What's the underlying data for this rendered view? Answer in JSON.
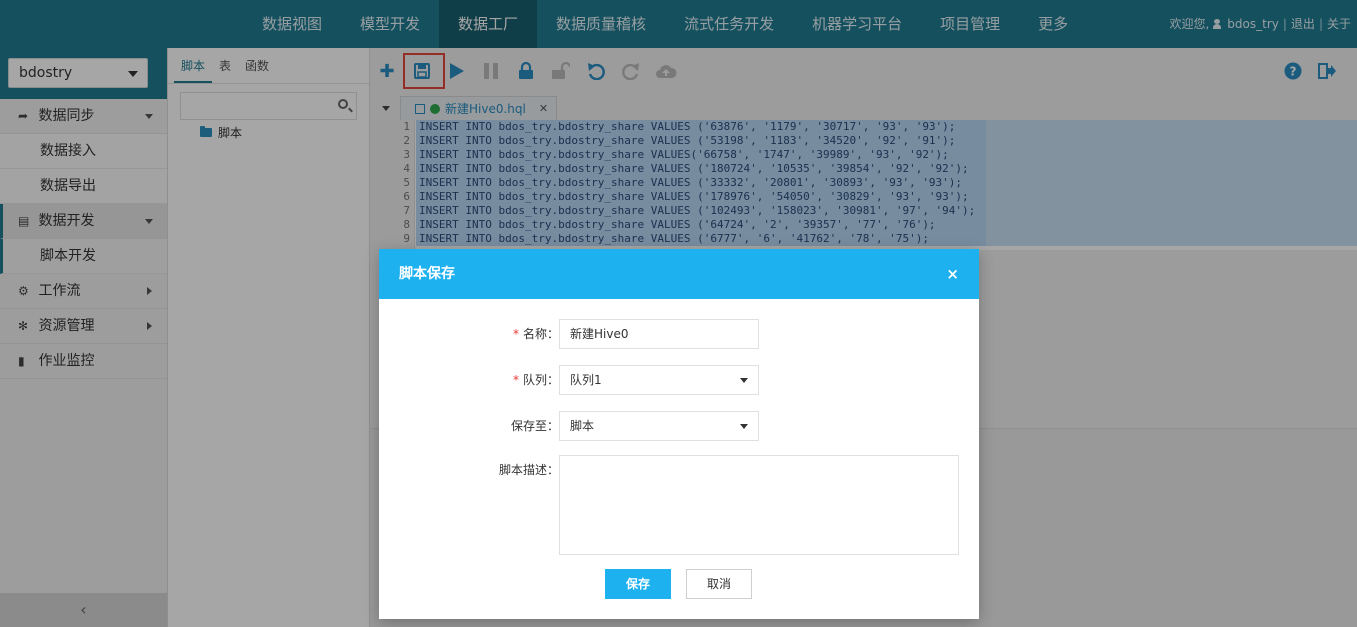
{
  "topnav": {
    "items": [
      "数据视图",
      "模型开发",
      "数据工厂",
      "数据质量稽核",
      "流式任务开发",
      "机器学习平台",
      "项目管理",
      "更多"
    ],
    "active_index": 2,
    "welcome": "欢迎您,",
    "username": "bdos_try",
    "logout": "退出",
    "about": "关于",
    "sep": "|"
  },
  "sidebar": {
    "project": "bdostry",
    "menu": [
      {
        "label": "数据同步",
        "icon": "share-icon"
      },
      {
        "label": "数据接入"
      },
      {
        "label": "数据导出"
      },
      {
        "label": "数据开发",
        "icon": "code-icon"
      },
      {
        "label": "脚本开发"
      },
      {
        "label": "工作流",
        "icon": "cogs-icon"
      },
      {
        "label": "资源管理",
        "icon": "gear-icon"
      },
      {
        "label": "作业监控",
        "icon": "server-icon"
      }
    ],
    "collapse_glyph": "‹"
  },
  "panel2": {
    "tabs": [
      "脚本",
      "表",
      "函数"
    ],
    "tree_root": "脚本"
  },
  "editor": {
    "file_tab": "新建Hive0.hql",
    "lines": [
      "INSERT INTO bdos_try.bdostry_share VALUES ('63876', '1179', '30717', '93', '93');",
      "INSERT INTO bdos_try.bdostry_share VALUES ('53198', '1183', '34520', '92', '91');",
      "INSERT INTO bdos_try.bdostry_share VALUES('66758', '1747', '39989', '93', '92');",
      "INSERT INTO bdos_try.bdostry_share VALUES ('180724', '10535', '39854', '92', '92');",
      "INSERT INTO bdos_try.bdostry_share VALUES ('33332', '20801', '30893', '93', '93');",
      "INSERT INTO bdos_try.bdostry_share VALUES ('178976', '54050', '30829', '93', '93');",
      "INSERT INTO bdos_try.bdostry_share VALUES ('102493', '158023', '30981', '97', '94');",
      "INSERT INTO bdos_try.bdostry_share VALUES ('64724', '2', '39357', '77', '76');",
      "INSERT INTO bdos_try.bdostry_share VALUES ('6777', '6', '41762', '78', '75');"
    ]
  },
  "dialog": {
    "title": "脚本保存",
    "close": "×",
    "name_label": "名称：",
    "name_value": "新建Hive0",
    "queue_label": "队列：",
    "queue_value": "队列1",
    "saveto_label": "保存至：",
    "saveto_value": "脚本",
    "desc_label": "脚本描述：",
    "required_mark": "*",
    "save_button": "保存",
    "cancel_button": "取消"
  },
  "colors": {
    "nav_bg": "#217b93",
    "dialog_header": "#1eb1ef",
    "highlight_border": "#e2463b"
  }
}
